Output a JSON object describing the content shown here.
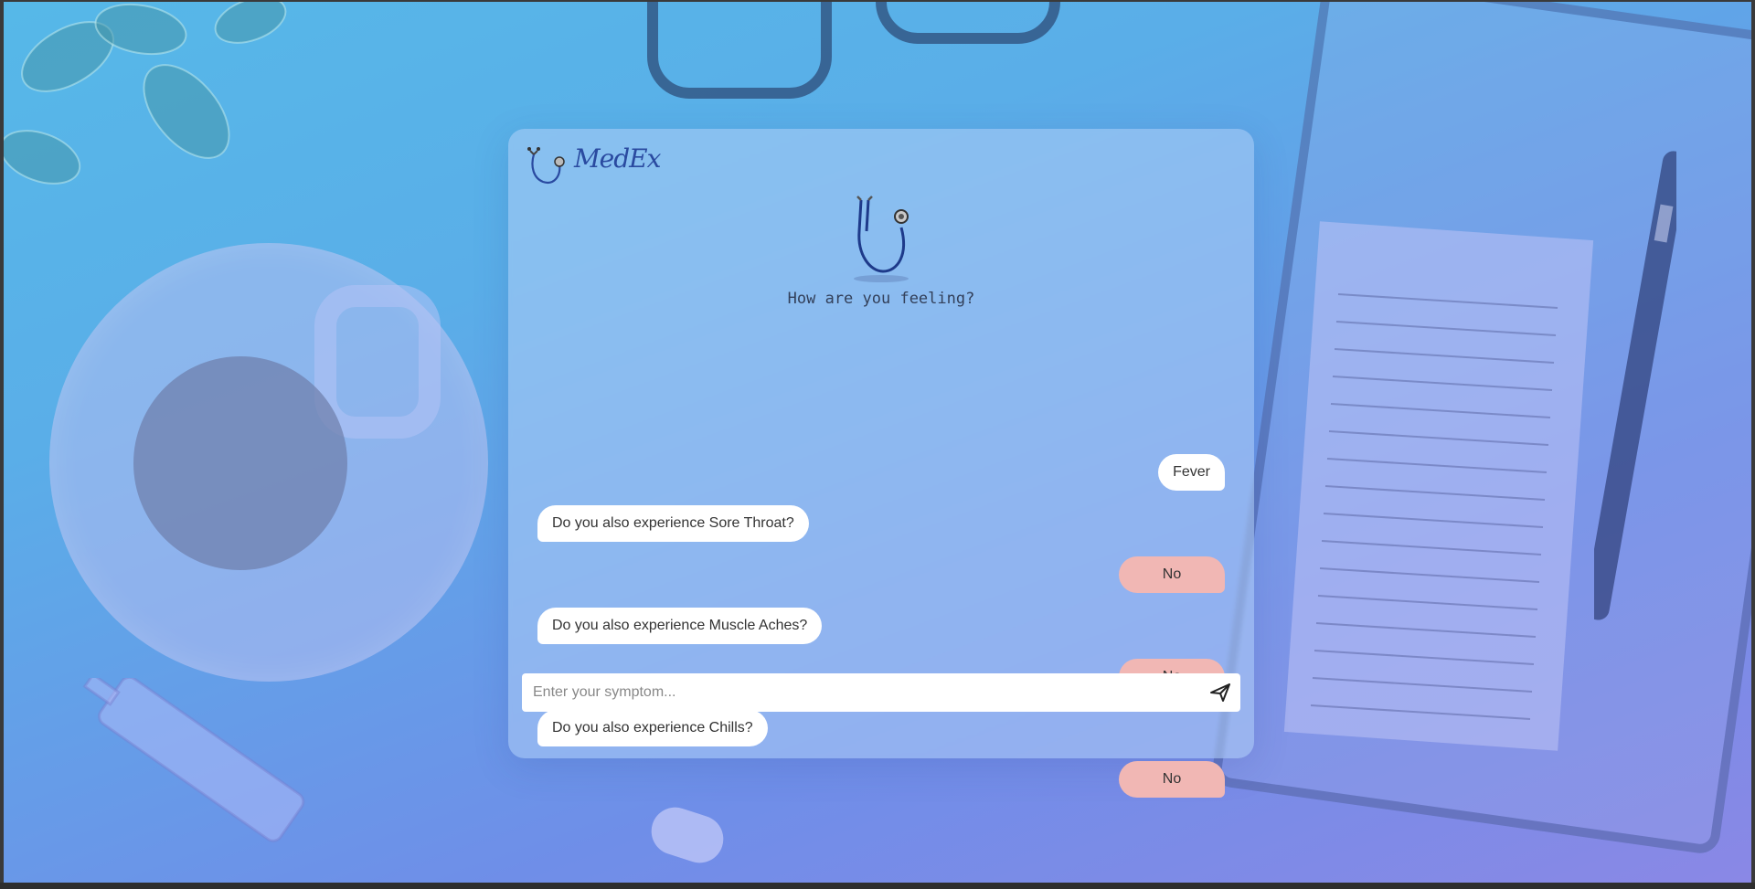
{
  "app": {
    "logo_text": "MedEx",
    "greeting": "How are you feeling?"
  },
  "messages": [
    {
      "sender": "user",
      "text": "Fever",
      "style": "white"
    },
    {
      "sender": "bot",
      "text": "Do you also experience Sore Throat?"
    },
    {
      "sender": "user",
      "text": "No",
      "style": "pink"
    },
    {
      "sender": "bot",
      "text": "Do you also experience Muscle Aches?"
    },
    {
      "sender": "user",
      "text": "No",
      "style": "pink"
    },
    {
      "sender": "bot",
      "text": "Do you also experience Chills?"
    },
    {
      "sender": "user",
      "text": "No",
      "style": "pink"
    }
  ],
  "input": {
    "placeholder": "Enter your symptom...",
    "value": ""
  },
  "icons": {
    "logo": "stethoscope-logo-icon",
    "hero": "stethoscope-icon",
    "send": "send-icon"
  },
  "colors": {
    "user_reply_bg": "#f1b7b4",
    "bubble_bg": "#ffffff",
    "logo_color": "#2a4aa0"
  }
}
